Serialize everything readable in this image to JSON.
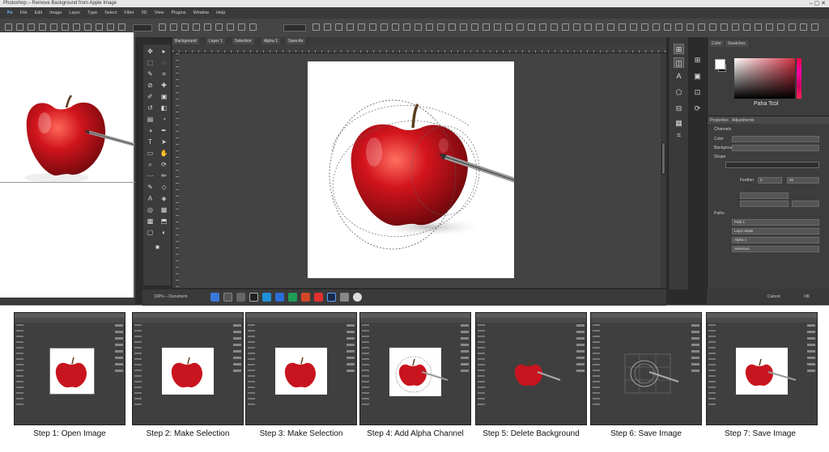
{
  "window": {
    "title": "Photoshop – Remove Background from Apple Image",
    "controls": "–  ▢  ✕"
  },
  "menu": [
    "Ps",
    "File",
    "Edit",
    "Image",
    "Layer",
    "Type",
    "Select",
    "Filter",
    "3D",
    "View",
    "Plugins",
    "Window",
    "Help"
  ],
  "document_tabs": [
    "Background",
    "Layer 1",
    "Selection",
    "Alpha 1",
    "Save As"
  ],
  "workspace": {
    "zoom_status": "100% – Document"
  },
  "color_panel": {
    "tabs": [
      "Color",
      "Swatches"
    ],
    "foreground": "#ffffff",
    "background": "#000000",
    "label": "Paha Tcol"
  },
  "properties_panel": {
    "tabs": [
      "Properties",
      "Adjustments"
    ],
    "section1": "Channels",
    "rows": [
      "Color",
      "Background",
      "Shape"
    ],
    "feather_label": "Feather",
    "feather_value": "0",
    "feather_value2": "32",
    "section2": "Paths",
    "path_rows": [
      "Path 1",
      "Layer Mask",
      "Alpha 1",
      "Selection"
    ],
    "buttons": [
      "Cancel",
      "OK"
    ]
  },
  "steps": [
    {
      "label": "Step 1: Open Image"
    },
    {
      "label": "Step 2: Make Selection"
    },
    {
      "label": "Step 3: Make Selection"
    },
    {
      "label": "Step 4: Add Alpha Channel"
    },
    {
      "label": "Step 5: Delete Background"
    },
    {
      "label": "Step 6: Save Image"
    },
    {
      "label": "Step 7: Save Image"
    }
  ],
  "colors": {
    "apple_red": "#c8141e",
    "ui_dark": "#2b2b2b",
    "workspace": "#434343"
  }
}
